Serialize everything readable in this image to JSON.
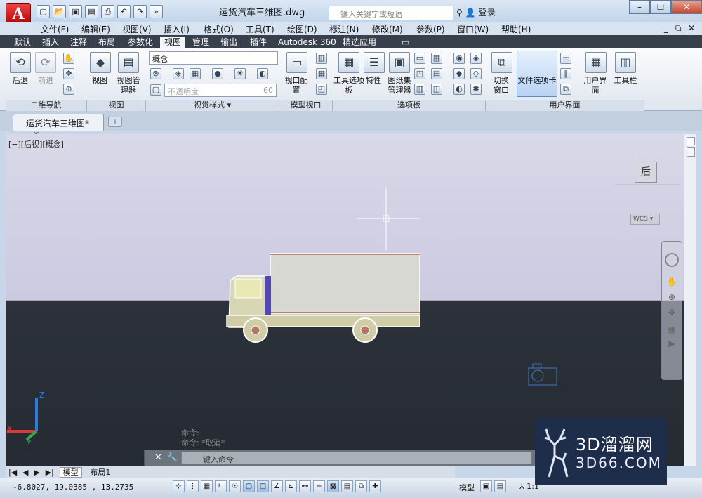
{
  "app": {
    "title": "运货汽车三维图.dwg",
    "logo_letter": "A"
  },
  "search": {
    "placeholder": "键入关键字或短语"
  },
  "user": {
    "login_label": "登录"
  },
  "window_controls": [
    "–",
    "☐",
    "✕"
  ],
  "menu": [
    "文件(F)",
    "编辑(E)",
    "视图(V)",
    "插入(I)",
    "格式(O)",
    "工具(T)",
    "绘图(D)",
    "标注(N)",
    "修改(M)",
    "参数(P)",
    "窗口(W)",
    "帮助(H)"
  ],
  "ribbon_tabs": [
    "默认",
    "插入",
    "注释",
    "布局",
    "参数化",
    "视图",
    "管理",
    "输出",
    "插件",
    "Autodesk 360",
    "精选应用"
  ],
  "active_ribbon_tab": "视图",
  "ribbon": {
    "nav_back": "后退",
    "nav_forward": "前进",
    "view_label": "视图",
    "view_manager_label": "视图管理器",
    "visual_style_value": "概念",
    "opacity_placeholder": "不透明度",
    "opacity_value": "60",
    "viewport_config_label": "视口配置",
    "tool_palette_label": "工具选项板",
    "properties_label": "特性",
    "sheetset_label": "图纸集管理器",
    "switch_window_label": "切换窗口",
    "file_tabs_label": "文件选项卡",
    "user_interface_label": "用户界面",
    "toolbar_label": "工具栏",
    "panels": [
      "二维导航",
      "视图",
      "视觉样式 ▾",
      "模型视口",
      "选项板",
      "用户界面"
    ]
  },
  "document_tab": {
    "label": "运货汽车三维图*",
    "close": "✕"
  },
  "viewport": {
    "label": "[−][后视][概念]",
    "viewcube_face": "后",
    "wcs_label": "WCS",
    "axis_labels": [
      "Z",
      "X",
      "Y"
    ]
  },
  "command": {
    "history": [
      "命令:",
      "命令: *取消*"
    ],
    "input_placeholder": "键入命令"
  },
  "layout_tabs": [
    "模型",
    "布局1"
  ],
  "status": {
    "coords": "-6.8027,  19.0385  , 13.2735",
    "model_label": "模型",
    "scale_label": "1:1"
  },
  "watermark": {
    "big": "3D溜溜网",
    "small": "3D66.COM"
  },
  "colors": {
    "accent": "#c21d1d",
    "ribbon_tab_bar": "#38404c",
    "viewport_sky": "#cbcae0",
    "viewport_ground": "#272c34"
  }
}
